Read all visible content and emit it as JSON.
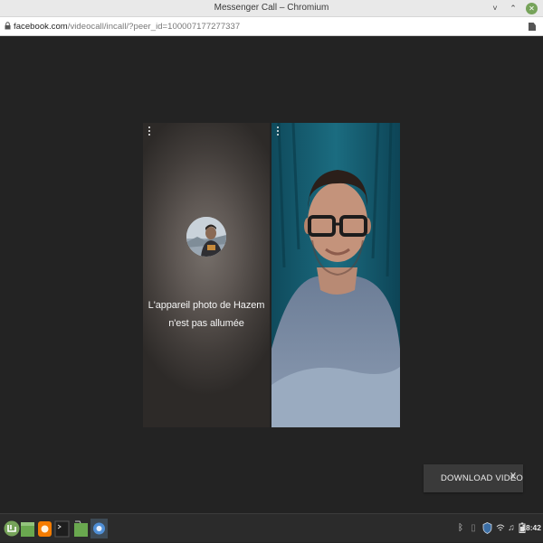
{
  "window": {
    "title": "Messenger Call – Chromium",
    "controls": {
      "minimize": "˅",
      "restore": "⌃",
      "close": "✕"
    }
  },
  "urlbar": {
    "host": "facebook.com",
    "path": "/videocall/incall/?peer_id=100007177277337",
    "icons": [
      "lock-icon",
      "page-icon"
    ]
  },
  "call": {
    "remote": {
      "camera_off_message": "L'appareil photo de Hazem n'est pas allumée",
      "menu_icon": "more-vertical-icon"
    },
    "self": {
      "menu_icon": "more-vertical-icon"
    }
  },
  "download_toast": {
    "label": "DOWNLOAD VIDEO",
    "close": "X"
  },
  "taskbar": {
    "apps": [
      "mint-menu-icon",
      "file-manager-icon",
      "firefox-icon",
      "terminal-icon",
      "files-icon",
      "chromium-icon"
    ],
    "tray_icons": [
      "bluetooth-icon",
      "network-icon",
      "shield-icon",
      "wifi-icon",
      "music-icon",
      "battery-icon"
    ],
    "clock": "18:42"
  },
  "colors": {
    "viewport_bg": "#232323",
    "titlebar_bg": "#e9e9e9",
    "taskbar_bg": "#2b2b2b",
    "toast_bg": "#3a3a3a",
    "mint_accent": "#76a35a"
  }
}
